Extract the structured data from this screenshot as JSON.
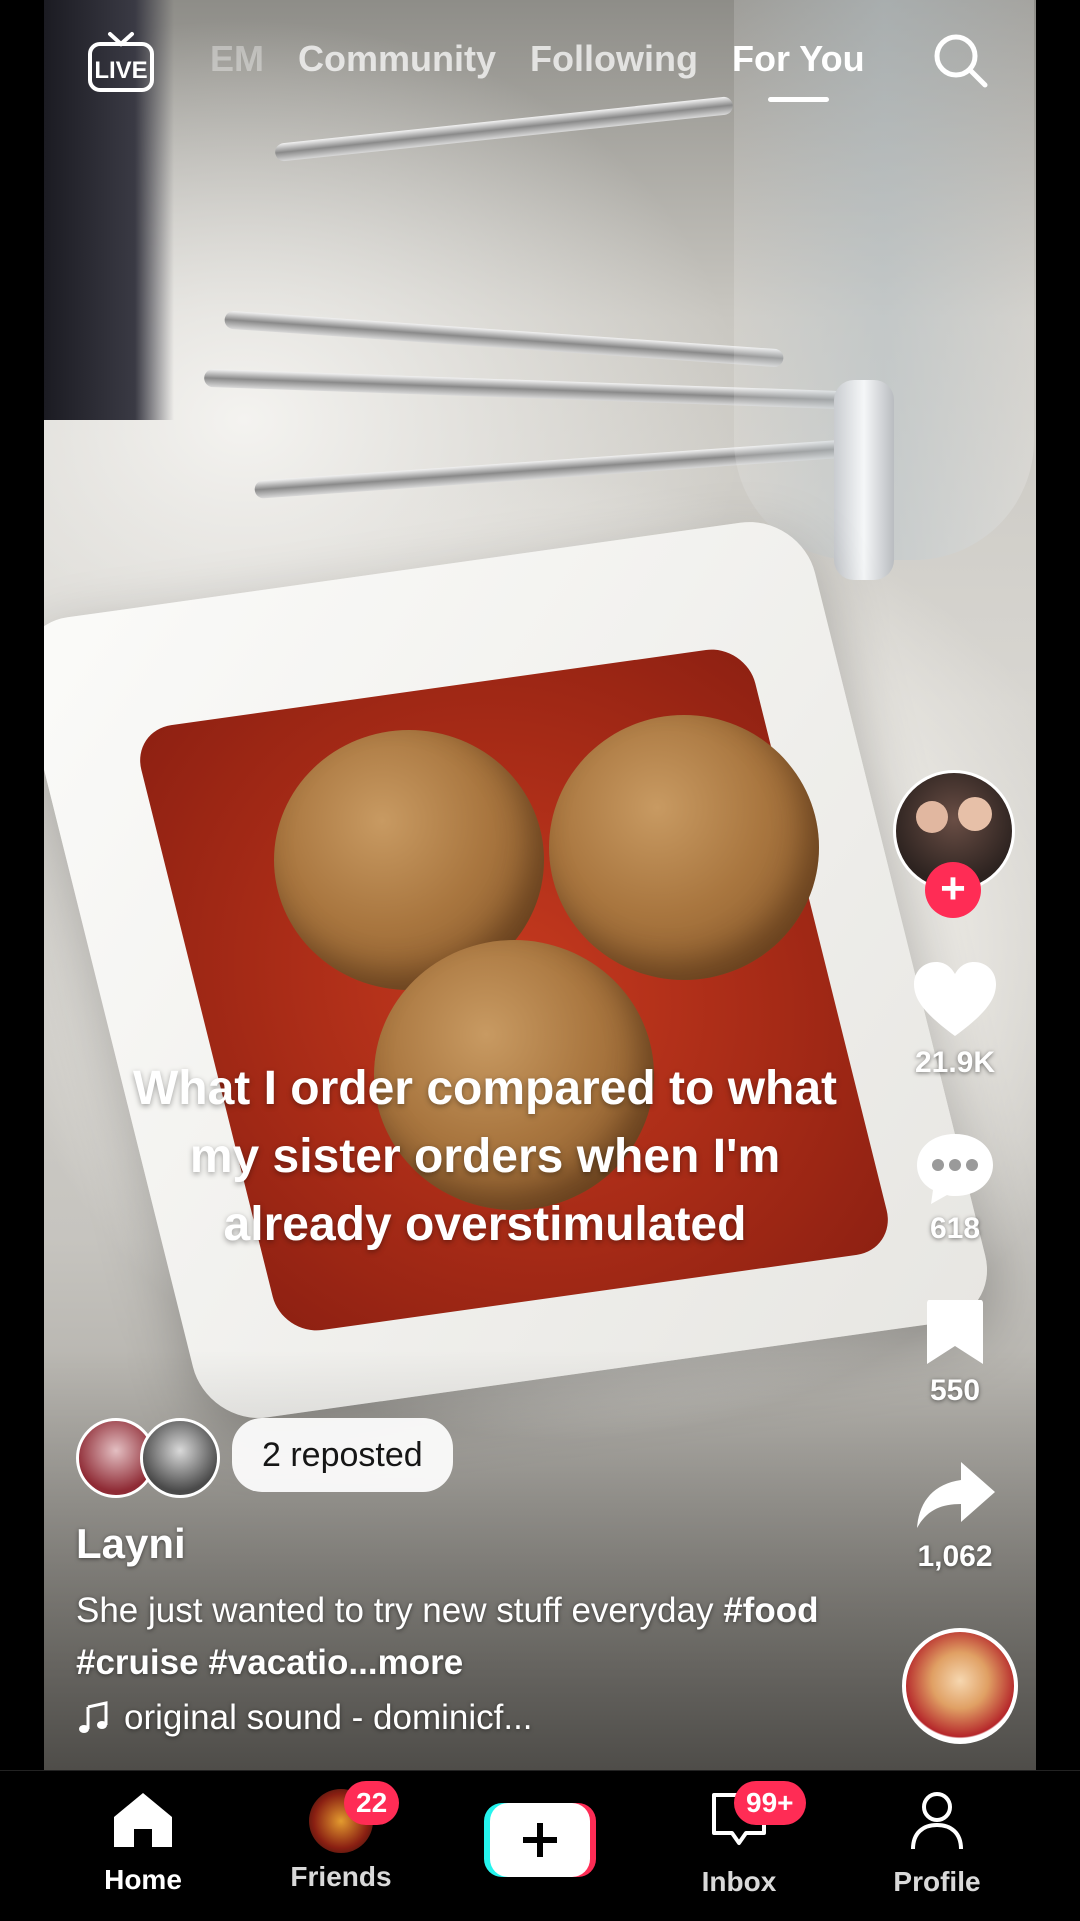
{
  "top_nav": {
    "live_icon": "live-tv-icon",
    "tabs": [
      {
        "label": "EM",
        "state": "faded"
      },
      {
        "label": "Community",
        "state": "inactive"
      },
      {
        "label": "Following",
        "state": "inactive"
      },
      {
        "label": "For You",
        "state": "active"
      }
    ],
    "search_icon": "search-icon"
  },
  "video": {
    "caption": "What I order compared to what my sister orders when I'm already overstimulated"
  },
  "right_rail": {
    "likes": "21.9K",
    "comments": "618",
    "bookmarks": "550",
    "shares": "1,062"
  },
  "post": {
    "repost_label": "2 reposted",
    "username": "Layni",
    "description_text": "She just wanted to try new stuff everyday ",
    "hashtags": [
      "#food",
      "#cruise",
      "#vacatio"
    ],
    "more_label": "...more",
    "sound": "original sound - dominicf..."
  },
  "bottom_bar": {
    "home_label": "Home",
    "friends_label": "Friends",
    "friends_badge": "22",
    "inbox_label": "Inbox",
    "inbox_badge": "99+",
    "profile_label": "Profile"
  },
  "colors": {
    "accent": "#ff2c55",
    "create_cyan": "#25f4ee",
    "create_red": "#fe2c55"
  }
}
